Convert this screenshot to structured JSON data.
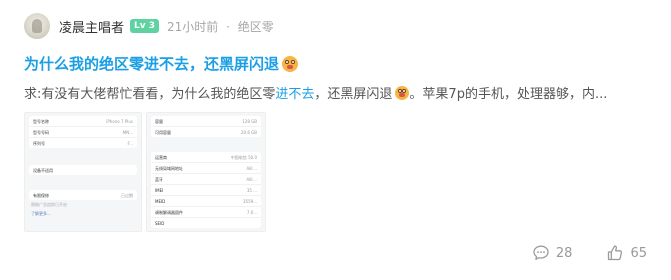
{
  "post": {
    "author": {
      "name": "凌晨主唱者",
      "level": "Lv 3"
    },
    "time": "21小时前",
    "separator": "·",
    "forum": "绝区零",
    "title": "为什么我的绝区零进不去，还黑屏闪退",
    "title_emoji": "dizzy-face-emoji",
    "summary": {
      "part1": "求:有没有大佬帮忙看看，为什么我的绝区零",
      "highlight": "进不去",
      "part2": "，还黑屏闪退",
      "part3": "。苹果7p的手机，处理器够，内..."
    },
    "images": [
      {
        "sections": [
          {
            "rows": [
              {
                "k": "型号名称",
                "v": "iPhone 7 Plus"
              },
              {
                "k": "型号号码",
                "v": "MN..."
              },
              {
                "k": "序列号",
                "v": "F..."
              }
            ]
          },
          {
            "rows": [
              {
                "k": "设备不适用",
                "v": ""
              }
            ]
          },
          {
            "rows": [
              {
                "k": "有限保修",
                "v": "已过期"
              }
            ]
          }
        ],
        "notes": [
          "限制广告追踪已开启",
          "了解更多..."
        ]
      },
      {
        "sections": [
          {
            "rows": [
              {
                "k": "容量",
                "v": "128 GB"
              },
              {
                "k": "可用容量",
                "v": "20.6 GB"
              }
            ]
          },
          {
            "rows": [
              {
                "k": "运营商",
                "v": "中国电信 50.0"
              },
              {
                "k": "无线局域网地址",
                "v": "A8:..."
              },
              {
                "k": "蓝牙",
                "v": "A8:..."
              },
              {
                "k": "IMEI",
                "v": "35 ..."
              },
              {
                "k": "MEID",
                "v": "3559..."
              },
              {
                "k": "调制解调器固件",
                "v": "7.0..."
              },
              {
                "k": "SEID",
                "v": ""
              }
            ]
          }
        ],
        "notes": []
      }
    ],
    "actions": {
      "comments": "28",
      "likes": "65"
    }
  },
  "colors": {
    "accent": "#1a9fe6",
    "level_badge": "#5ed2a1",
    "muted": "#a7a7a7"
  }
}
